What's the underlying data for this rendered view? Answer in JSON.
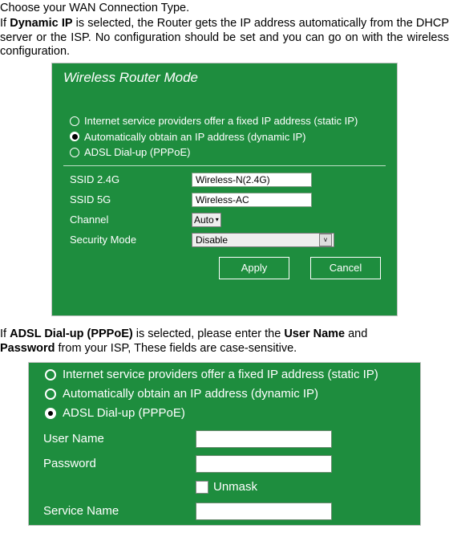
{
  "intro": {
    "line1": "Choose your WAN Connection Type.",
    "dynamic_prefix": "If ",
    "dynamic_bold": "Dynamic IP",
    "dynamic_rest": " is selected, the Router gets the IP address automatically from the DHCP server or the ISP. No configuration should be set and you can go on with the wireless configuration."
  },
  "panel1": {
    "title": "Wireless Router Mode",
    "radios": {
      "static": "Internet service providers offer a fixed IP address (static IP)",
      "dynamic": "Automatically obtain an IP address (dynamic IP)",
      "pppoe": "ADSL Dial-up (PPPoE)"
    },
    "fields": {
      "ssid24_label": "SSID 2.4G",
      "ssid24_value": "Wireless-N(2.4G)",
      "ssid5_label": "SSID 5G",
      "ssid5_value": "Wireless-AC",
      "channel_label": "Channel",
      "channel_value": "Auto",
      "secmode_label": "Security Mode",
      "secmode_value": "Disable"
    },
    "buttons": {
      "apply": "Apply",
      "cancel": "Cancel"
    }
  },
  "mid_text": {
    "prefix": "If ",
    "b1": "ADSL Dial-up (PPPoE)",
    "mid": " is selected, please enter the ",
    "b2": "User Name",
    "mid2": " and ",
    "b3": "Password",
    "suffix": " from your ISP, These fields are case-sensitive."
  },
  "panel2": {
    "radios": {
      "static": "Internet service providers offer a fixed IP address (static IP)",
      "dynamic": "Automatically obtain an IP address (dynamic IP)",
      "pppoe": "ADSL Dial-up (PPPoE)"
    },
    "fields": {
      "user_label": "User Name",
      "pass_label": "Password",
      "unmask": "Unmask",
      "service_label": "Service Name"
    }
  }
}
